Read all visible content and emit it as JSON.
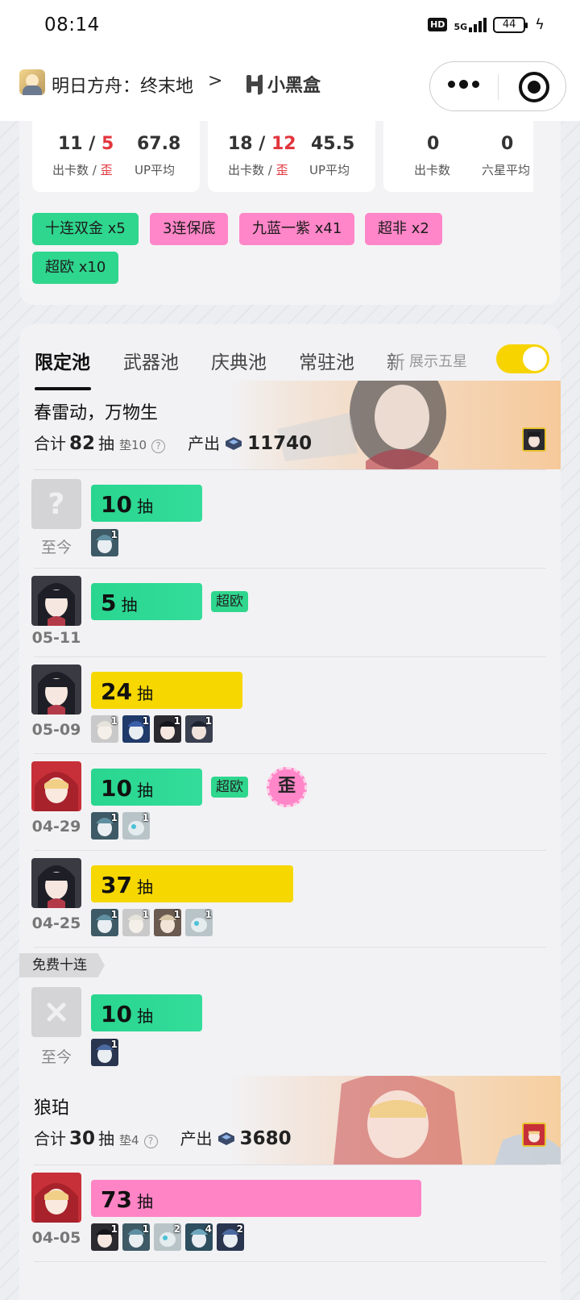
{
  "status_bar": {
    "time": "08:14",
    "hd": "HD",
    "network": "5G",
    "battery": "44"
  },
  "nav": {
    "game_title": "明日方舟：终末地",
    "chevron": ">",
    "logo_text": "小黑盒"
  },
  "summary": {
    "stats": [
      {
        "count": "11",
        "wai": "5",
        "avg": "67.8",
        "label_count": "出卡数",
        "label_wai": "歪",
        "label_avg": "UP平均"
      },
      {
        "count": "18",
        "wai": "12",
        "avg": "45.5",
        "label_count": "出卡数",
        "label_wai": "歪",
        "label_avg": "UP平均"
      },
      {
        "count": "0",
        "avg": "0",
        "label_count": "出卡数",
        "label_avg": "六星平均"
      }
    ],
    "tags": [
      {
        "text": "十连双金 x5",
        "color": "green"
      },
      {
        "text": "3连保底",
        "color": "pink"
      },
      {
        "text": "九蓝一紫 x41",
        "color": "pink"
      },
      {
        "text": "超非 x2",
        "color": "pink"
      },
      {
        "text": "超欧 x10",
        "color": "green"
      }
    ]
  },
  "tabs": {
    "items": [
      "限定池",
      "武器池",
      "庆典池",
      "常驻池",
      "新"
    ],
    "active": "限定池",
    "toggle_label": "展示五星",
    "toggle_on": true
  },
  "pools": [
    {
      "name": "春雷动，万物生",
      "total_label": "合计",
      "total_pulls": "82",
      "pull_unit": "抽",
      "pity": "垫10",
      "produce_label": "产出",
      "produce_value": "11740"
    },
    {
      "name": "狼珀",
      "total_label": "合计",
      "total_pulls": "30",
      "pull_unit": "抽",
      "pity": "垫4",
      "produce_label": "产出",
      "produce_value": "3680"
    }
  ],
  "records": [
    {
      "date": "至今",
      "pulls": "10",
      "unit": "抽",
      "bar": "green",
      "avatar": "unknown",
      "minis": [
        {
          "count": "1"
        }
      ]
    },
    {
      "date": "05-11",
      "pulls": "5",
      "unit": "抽",
      "bar": "green",
      "tag": "超欧",
      "avatar": "dark-hair",
      "minis": []
    },
    {
      "date": "05-09",
      "pulls": "24",
      "unit": "抽",
      "bar": "yellow",
      "avatar": "dark-hair",
      "minis": [
        {
          "count": "1"
        },
        {
          "count": "1"
        },
        {
          "count": "1"
        },
        {
          "count": "1"
        }
      ]
    },
    {
      "date": "04-29",
      "pulls": "10",
      "unit": "抽",
      "bar": "green",
      "tag": "超欧",
      "badge": "歪",
      "avatar": "red-hood",
      "minis": [
        {
          "count": "1"
        },
        {
          "count": "1"
        }
      ]
    },
    {
      "date": "04-25",
      "pulls": "37",
      "unit": "抽",
      "bar": "yellow",
      "avatar": "dark-hair",
      "minis": [
        {
          "count": "1"
        },
        {
          "count": "1"
        },
        {
          "count": "1"
        },
        {
          "count": "1"
        }
      ]
    },
    {
      "date": "至今",
      "pulls": "10",
      "unit": "抽",
      "bar": "green",
      "avatar": "cross",
      "free_label": "免费十连",
      "minis": [
        {
          "count": "1"
        }
      ]
    },
    {
      "date": "04-05",
      "pulls": "73",
      "unit": "抽",
      "bar": "pink",
      "avatar": "red-hood",
      "minis": [
        {
          "count": "1"
        },
        {
          "count": "1"
        },
        {
          "count": "2"
        },
        {
          "count": "4"
        },
        {
          "count": "2"
        }
      ]
    }
  ],
  "colors": {
    "green": "#2fd68e",
    "yellow": "#f6d700",
    "pink": "#ff84c5",
    "red_text": "#e2353c",
    "toggle": "#f7d400"
  }
}
